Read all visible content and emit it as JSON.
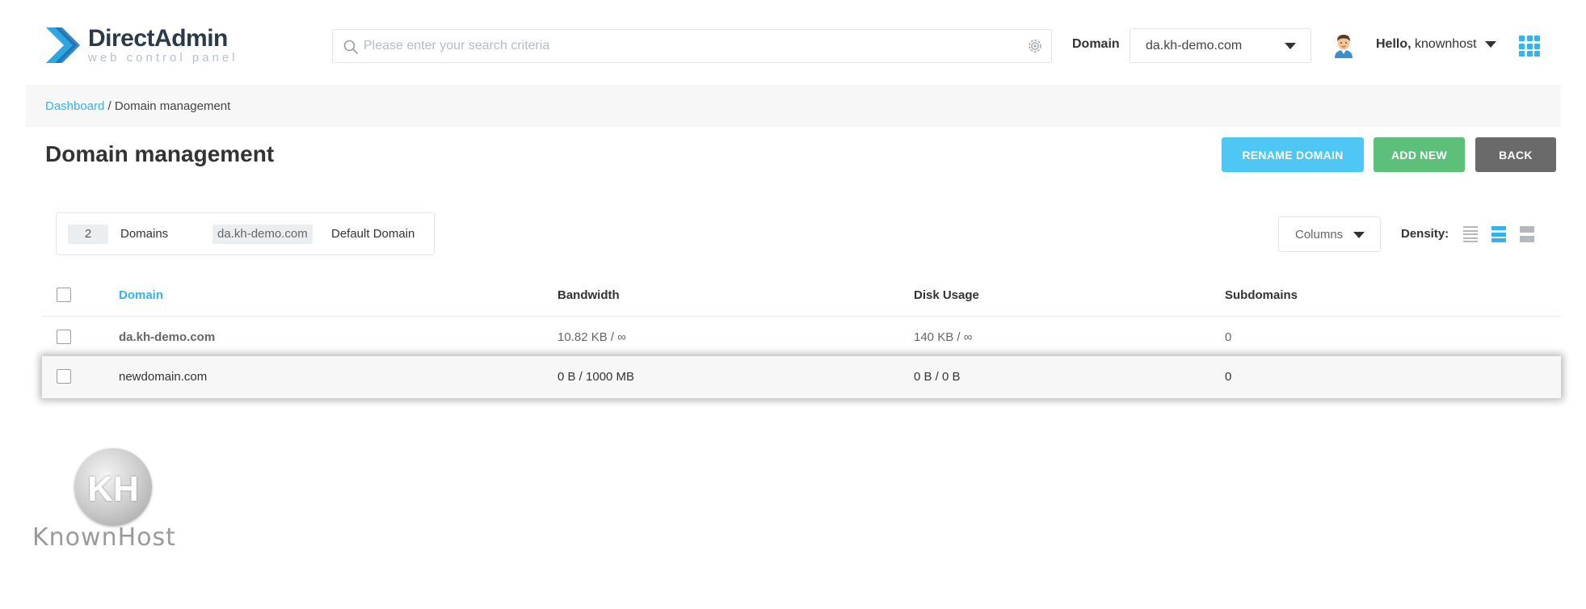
{
  "header": {
    "logo_title": "DirectAdmin",
    "logo_subtitle": "web control panel",
    "search_placeholder": "Please enter your search criteria",
    "domain_label": "Domain",
    "domain_selected": "da.kh-demo.com",
    "hello_prefix": "Hello,",
    "username": "knownhost"
  },
  "breadcrumb": {
    "root": "Dashboard",
    "separator": " / ",
    "current": "Domain management"
  },
  "page": {
    "title": "Domain management",
    "buttons": {
      "rename": "RENAME DOMAIN",
      "add_new": "ADD NEW",
      "back": "BACK"
    }
  },
  "stats": {
    "count": "2",
    "count_label": "Domains",
    "default_domain": "da.kh-demo.com",
    "default_label": "Default Domain"
  },
  "controls": {
    "columns_label": "Columns",
    "density_label": "Density:",
    "density_selected": "medium"
  },
  "table": {
    "columns": [
      "Domain",
      "Bandwidth",
      "Disk Usage",
      "Subdomains"
    ],
    "rows": [
      {
        "domain": "da.kh-demo.com",
        "bandwidth": "10.82 KB / ∞",
        "disk": "140 KB / ∞",
        "subdomains": "0"
      },
      {
        "domain": "newdomain.com",
        "bandwidth": "0 B / 1000 MB",
        "disk": "0 B / 0 B",
        "subdomains": "0",
        "highlighted": true
      }
    ]
  },
  "watermark": {
    "monogram": "KH",
    "text": "KnownHost"
  },
  "colors": {
    "accent": "#35b3ee",
    "rename_button": "#4ec7f4",
    "add_button": "#5cc07a",
    "back_button": "#6a6a6a"
  }
}
